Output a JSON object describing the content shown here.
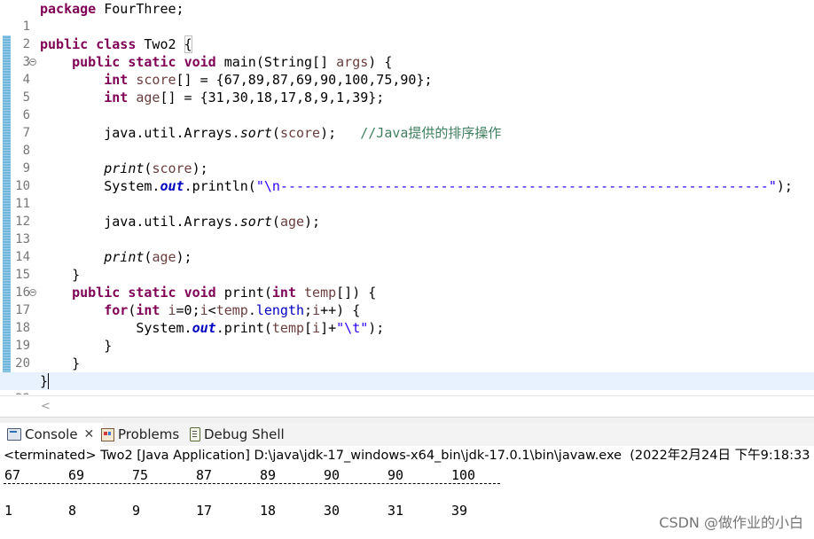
{
  "editor": {
    "lines": [
      {
        "n": "1"
      },
      {
        "n": "2"
      },
      {
        "n": "3"
      },
      {
        "n": "4"
      },
      {
        "n": "5"
      },
      {
        "n": "6"
      },
      {
        "n": "7"
      },
      {
        "n": "8"
      },
      {
        "n": "9"
      },
      {
        "n": "10"
      },
      {
        "n": "11"
      },
      {
        "n": "12"
      },
      {
        "n": "13"
      },
      {
        "n": "14"
      },
      {
        "n": "15"
      },
      {
        "n": "16"
      },
      {
        "n": "17"
      },
      {
        "n": "18"
      },
      {
        "n": "19"
      },
      {
        "n": "20"
      },
      {
        "n": "21"
      },
      {
        "n": "22"
      }
    ],
    "code": {
      "l1_kw": "package",
      "l1_rest": " FourThree;",
      "l3_kw1": "public",
      "l3_kw2": "class",
      "l3_name": " Two2 ",
      "l3_brace": "{",
      "l4_kw1": "public",
      "l4_kw2": "static",
      "l4_kw3": "void",
      "l4_a": " main(String[] ",
      "l4_var": "args",
      "l4_b": ") {",
      "l5_kw": "int",
      "l5_var": "score",
      "l5_rest": "[] = {67,89,87,69,90,100,75,90};",
      "l6_kw": "int",
      "l6_var": "age",
      "l6_rest": "[] = {31,30,18,17,8,9,1,39};",
      "l8_a": "java.util.Arrays.",
      "l8_m": "sort",
      "l8_b": "(",
      "l8_var": "score",
      "l8_c": ");   ",
      "l8_cmt": "//Java提供的排序操作",
      "l10_m": "print",
      "l10_a": "(",
      "l10_var": "score",
      "l10_b": ");",
      "l11_a": "System.",
      "l11_f": "out",
      "l11_b": ".println(",
      "l11_str": "\"\\n-------------------------------------------------------------\"",
      "l11_c": ");",
      "l13_a": "java.util.Arrays.",
      "l13_m": "sort",
      "l13_b": "(",
      "l13_var": "age",
      "l13_c": ");",
      "l15_m": "print",
      "l15_a": "(",
      "l15_var": "age",
      "l15_b": ");",
      "l16": "}",
      "l17_kw1": "public",
      "l17_kw2": "static",
      "l17_kw3": "void",
      "l17_a": " print(",
      "l17_kw4": "int",
      "l17_var": "temp",
      "l17_b": "[]) {",
      "l18_kw1": "for",
      "l18_a": "(",
      "l18_kw2": "int",
      "l18_var1": "i",
      "l18_b": "=0;",
      "l18_var2": "i",
      "l18_c": "<",
      "l18_var3": "temp",
      "l18_d": ".",
      "l18_f": "length",
      "l18_e": ";",
      "l18_var4": "i",
      "l18_g": "++) {",
      "l19_a": "System.",
      "l19_f": "out",
      "l19_b": ".print(",
      "l19_var": "temp",
      "l19_c": "[",
      "l19_var2": "i",
      "l19_d": "]+",
      "l19_str": "\"\\t\"",
      "l19_e": ");",
      "l20": "}",
      "l21": "}",
      "l22": "}"
    },
    "scroll_left_glyph": "<"
  },
  "console_tabs": [
    {
      "label": "Console",
      "close": "✕"
    },
    {
      "label": "Problems"
    },
    {
      "label": "Debug Shell"
    }
  ],
  "console": {
    "status": "<terminated> Two2 [Java Application] D:\\java\\jdk-17_windows-x64_bin\\jdk-17.0.1\\bin\\javaw.exe  (2022年2月24日 下午9:18:33 -",
    "row1": [
      "67",
      "69",
      "75",
      "87",
      "89",
      "90",
      "90",
      "100"
    ],
    "row2": [
      "1",
      "8",
      "9",
      "17",
      "18",
      "30",
      "31",
      "39"
    ]
  },
  "watermark": "CSDN @做作业的小白"
}
